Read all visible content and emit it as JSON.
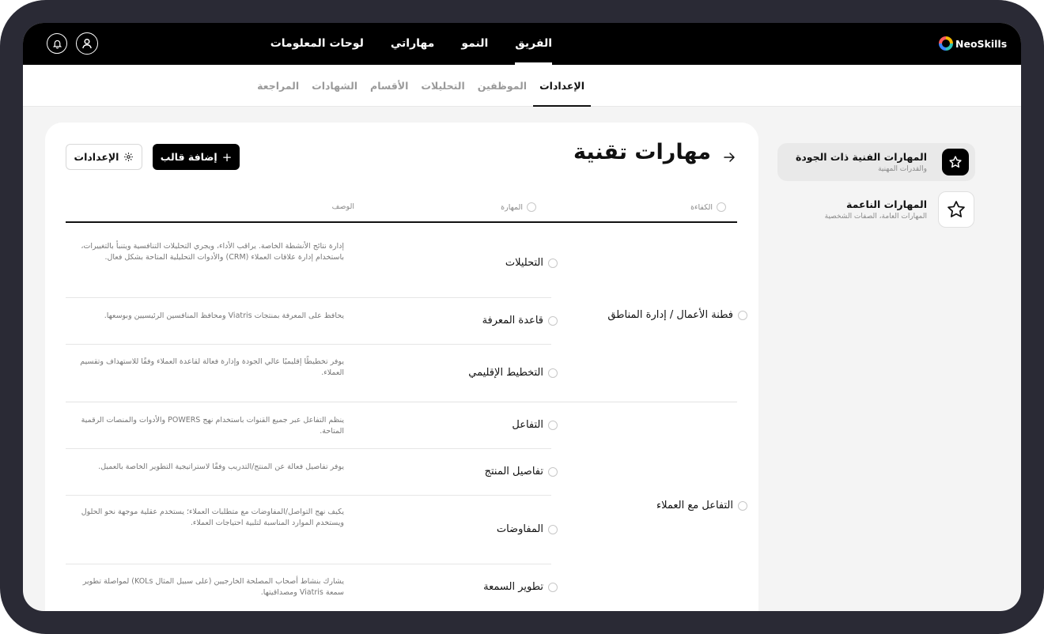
{
  "brand": {
    "name": "NeoSkills"
  },
  "top_nav": {
    "items": [
      {
        "label": "الفريق",
        "active": true
      },
      {
        "label": "النمو",
        "active": false
      },
      {
        "label": "مهاراتي",
        "active": false
      },
      {
        "label": "لوحات المعلومات",
        "active": false
      }
    ]
  },
  "sub_nav": {
    "items": [
      {
        "label": "الإعدادات",
        "active": true
      },
      {
        "label": "الموظفين",
        "active": false
      },
      {
        "label": "التحليلات",
        "active": false
      },
      {
        "label": "الأقسام",
        "active": false
      },
      {
        "label": "الشهادات",
        "active": false
      },
      {
        "label": "المراجعة",
        "active": false
      }
    ]
  },
  "sidebar": {
    "items": [
      {
        "title": "المهارات الفنية ذات الجودة",
        "subtitle": "والقدرات المهنية",
        "active": true,
        "icon": "star-icon"
      },
      {
        "title": "المهارات الناعمة",
        "subtitle": "المهارات العامة، الصفات الشخصية",
        "active": false,
        "icon": "star-icon"
      }
    ]
  },
  "main": {
    "title": "مهارات تقنية",
    "add_template_label": "إضافة قالب",
    "settings_label": "الإعدادات",
    "columns": {
      "competency": "الكفاءة",
      "skill": "المهارة",
      "description": "الوصف"
    },
    "groups": [
      {
        "competency": "فطنة الأعمال / إدارة المناطق",
        "rows": [
          {
            "skill": "التحليلات",
            "description": "إدارة نتائج الأنشطة الخاصة. يراقب الأداء، ويجري التحليلات التنافسية ويتنبأ بالتغييرات، باستخدام إدارة علاقات العملاء (CRM) والأدوات التحليلية المتاحة بشكل فعال."
          },
          {
            "skill": "قاعدة المعرفة",
            "description": "يحافظ على المعرفة بمنتجات Viatris ومحافظ المنافسين الرئيسيين وبوسعها."
          },
          {
            "skill": "التخطيط الإقليمي",
            "description": "يوفر تخطيطًا إقليميًا عالي الجودة وإدارة فعالة لقاعدة العملاء وفقًا للاستهداف وتقسيم العملاء."
          }
        ]
      },
      {
        "competency": "التفاعل مع العملاء",
        "rows": [
          {
            "skill": "التفاعل",
            "description": "ينظم التفاعل عبر جميع القنوات باستخدام نهج POWERS والأدوات والمنصات الرقمية المتاحة."
          },
          {
            "skill": "تفاصيل المنتج",
            "description": "يوفر تفاصيل فعالة عن المنتج/التدريب وفقًا لاستراتيجية التطوير الخاصة بالعميل."
          },
          {
            "skill": "المفاوضات",
            "description": "يكيف نهج التواصل/المفاوضات مع متطلبات العملاء؛ يستخدم عقلية موجهة نحو الحلول ويستخدم الموارد المناسبة لتلبية احتياجات العملاء."
          },
          {
            "skill": "تطوير السمعة",
            "description": "يشارك بنشاط أصحاب المصلحة الخارجيين (على سبيل المثال KOLs) لمواصلة تطوير سمعة Viatris ومصداقيتها."
          }
        ]
      }
    ]
  }
}
